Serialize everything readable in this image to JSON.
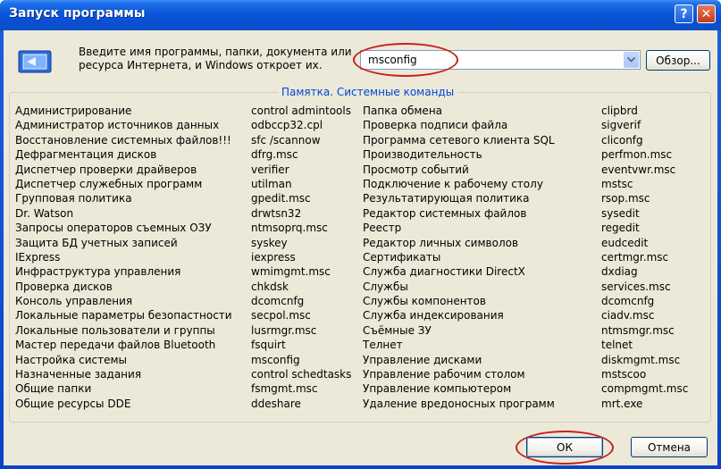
{
  "window": {
    "title": "Запуск программы",
    "help_glyph": "?",
    "close_glyph": "✕"
  },
  "prompt": {
    "line1": "Введите имя программы, папки, документа или",
    "line2": "ресурса Интернета, и Windows откроет их."
  },
  "command_input": {
    "value": "msconfig"
  },
  "buttons": {
    "browse": "Обзор...",
    "ok": "ОК",
    "cancel": "Отмена"
  },
  "memo": {
    "legend": "Памятка. Системные команды",
    "left_names": [
      "Администрирование",
      "Администратор источников данных",
      "Восстановление системных файлов!!!",
      "Дефрагментация дисков",
      "Диспетчер проверки драйверов",
      "Диспетчер служебных программ",
      "Групповая политика",
      "Dr. Watson",
      "Запросы операторов съемных ОЗУ",
      "Защита БД учетных записей",
      "IExpress",
      "Инфраструктура управления",
      "Проверка дисков",
      "Консоль управления",
      "Локальные параметры безопастности",
      "Локальные пользователи и группы",
      "Мастер передачи файлов Bluetooth",
      "Настройка системы",
      "Назначенные задания",
      "Общие папки",
      "Общие ресурсы DDE"
    ],
    "left_commands": [
      "control admintools",
      "odbccp32.cpl",
      "sfc /scannow",
      "dfrg.msc",
      "verifier",
      "utilman",
      "gpedit.msc",
      "drwtsn32",
      "ntmsoprq.msc",
      "syskey",
      "iexpress",
      "wmimgmt.msc",
      "chkdsk",
      "dcomcnfg",
      "secpol.msc",
      "lusrmgr.msc",
      "fsquirt",
      "msconfig",
      "control schedtasks",
      "fsmgmt.msc",
      "ddeshare"
    ],
    "right_names": [
      "Папка обмена",
      "Проверка подписи файла",
      "Программа сетевого клиента SQL",
      "Производительность",
      "Просмотр событий",
      "Подключение к рабочему столу",
      "Результатирующая политика",
      "Редактор системных файлов",
      "Реестр",
      "Редактор личных символов",
      "Сертификаты",
      "Служба диагностики DirectX",
      "Службы",
      "Службы компонентов",
      "Служба индексирования",
      "Съёмные ЗУ",
      "Телнет",
      "Управление дисками",
      "Управление рабочим столом",
      "Управление компьютером",
      "Удаление вредоносных программ"
    ],
    "right_commands": [
      "clipbrd",
      "sigverif",
      "cliconfg",
      "perfmon.msc",
      "eventvwr.msc",
      "mstsc",
      "rsop.msc",
      "sysedit",
      "regedit",
      "eudcedit",
      "certmgr.msc",
      "dxdiag",
      "services.msc",
      "dcomcnfg",
      "ciadv.msc",
      "ntmsmgr.msc",
      "telnet",
      "diskmgmt.msc",
      "mstscoo",
      "compmgmt.msc",
      "mrt.exe"
    ]
  },
  "colors": {
    "title_bar": "#0a56d8",
    "dialog_bg": "#ece9d8",
    "legend_text": "#0046d5",
    "highlight_oval": "#c8201f"
  }
}
